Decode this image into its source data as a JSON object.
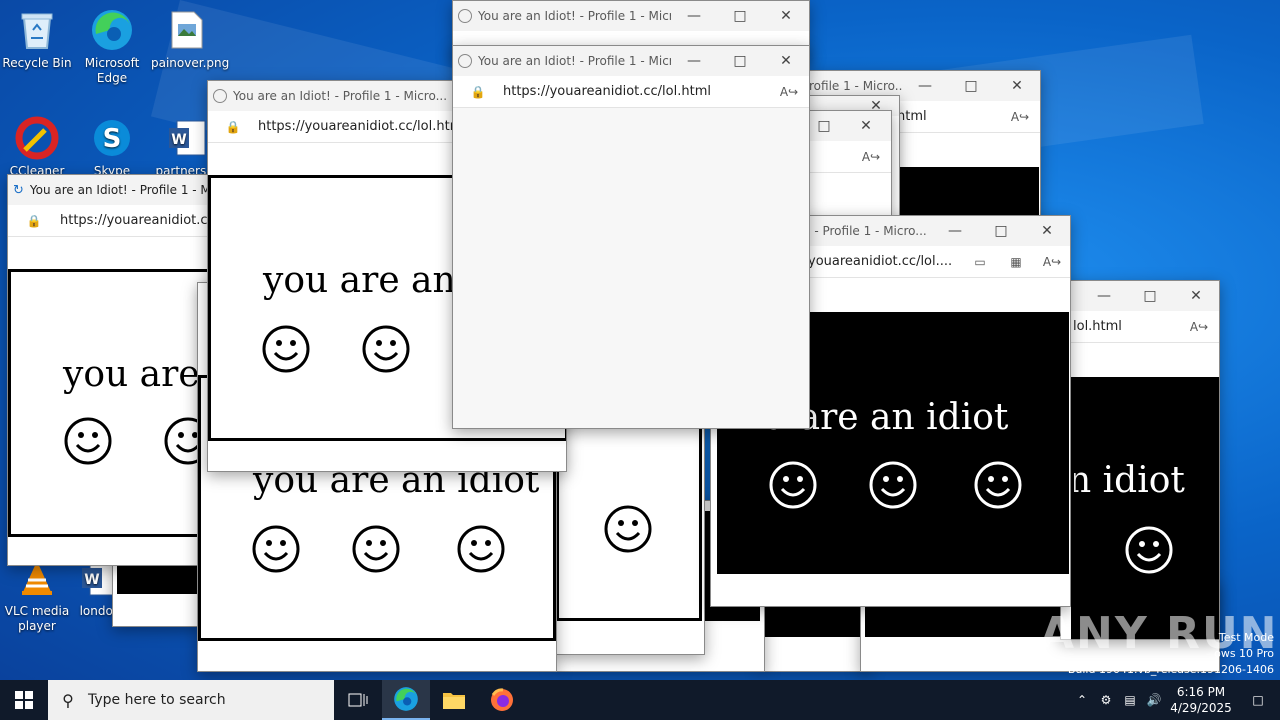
{
  "desktop": {
    "icons": [
      {
        "label": "Recycle Bin",
        "icon": "recycle-bin-icon"
      },
      {
        "label": "Microsoft Edge",
        "icon": "edge-icon"
      },
      {
        "label": "painover.png",
        "icon": "image-file-icon"
      },
      {
        "label": "CCleaner",
        "icon": "ccleaner-icon"
      },
      {
        "label": "Skype",
        "icon": "skype-icon"
      },
      {
        "label": "partnersar",
        "icon": "word-document-icon"
      },
      {
        "label": "VLC media player",
        "icon": "vlc-icon"
      },
      {
        "label": "london",
        "icon": "word-document-icon"
      }
    ]
  },
  "popup": {
    "title": "You are an Idiot! - Profile 1 - Micro...",
    "title_short": "You are an Idiot! - Profile 1 - Micr",
    "title_right1": "rofile 1 - Micro...",
    "title_right2": "t! - Profile 1 - Micro...",
    "url": "https://youareanidiot.cc/lol.html",
    "url_short": "https://youareanidiot.cc/lol.html",
    "url_partial": "youareanidiot.cc/lol....",
    "url_tail": "lol.html",
    "url_tail2": "html",
    "message": "you are an idiot",
    "message_cut1": "you are an i",
    "message_cut2": "you are a",
    "message_cut3": "u are an idiot",
    "message_cut4": "n idiot"
  },
  "taskbar": {
    "search_placeholder": "Type here to search",
    "time": "6:16 PM",
    "date": "4/29/2025"
  },
  "system": {
    "test_mode": "Test Mode",
    "edition": "ows 10 Pro",
    "build": "Build 19041.vb_release.191206-1406",
    "watermark": "ANY RUN"
  }
}
